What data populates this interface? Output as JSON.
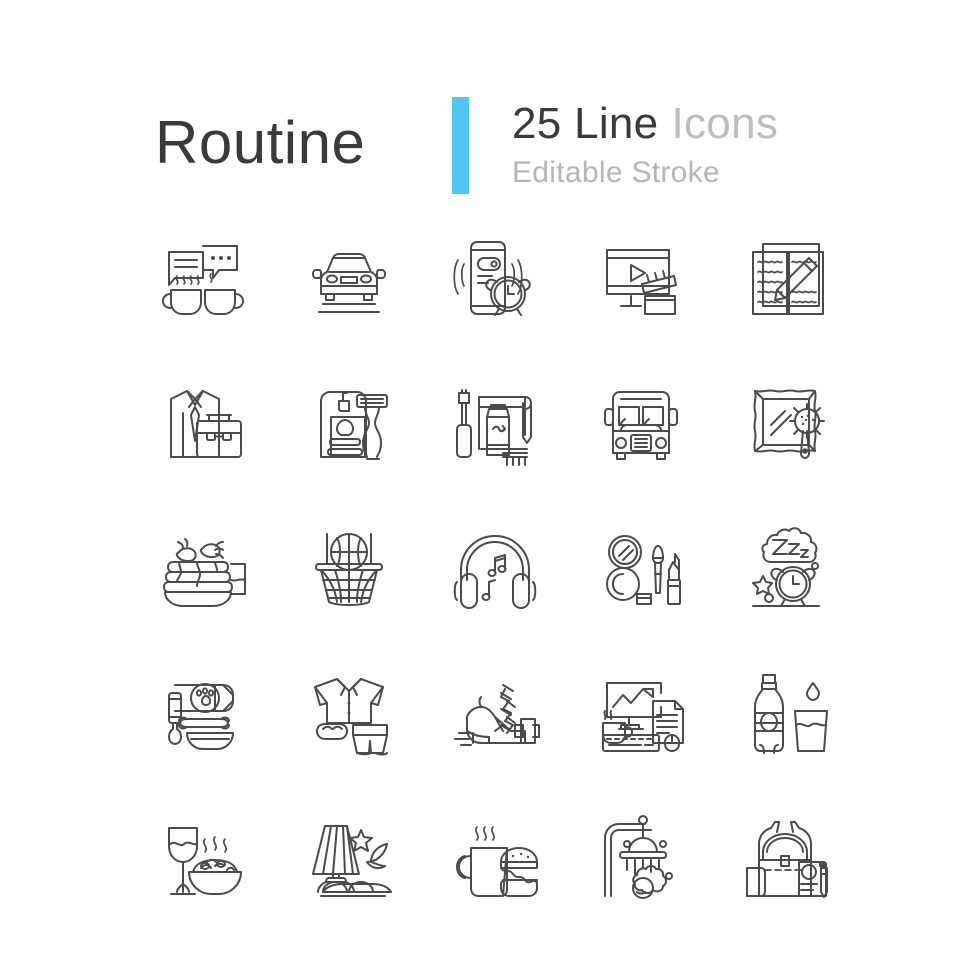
{
  "header": {
    "title": "Routine",
    "count_label": "25 Line",
    "muted_label": "Icons",
    "subtitle": "Editable Stroke",
    "accent_color": "#4ec8f0",
    "text_color": "#3a3a3c",
    "muted_color": "#b5b5b5"
  },
  "grid": {
    "columns": 5,
    "rows": 5,
    "total": 25,
    "stroke_color": "#4a4a4f",
    "background": "#ffffff"
  },
  "icons": [
    {
      "index": 1,
      "name": "coffee-chat-icon",
      "label": "Morning coffee and chat"
    },
    {
      "index": 2,
      "name": "car-commute-icon",
      "label": "Commute by car"
    },
    {
      "index": 3,
      "name": "phone-alarm-icon",
      "label": "Phone alarm clock"
    },
    {
      "index": 4,
      "name": "watch-video-icon",
      "label": "Watching video on monitor"
    },
    {
      "index": 5,
      "name": "journal-writing-icon",
      "label": "Writing in journal"
    },
    {
      "index": 6,
      "name": "work-clothes-icon",
      "label": "Shirt, tie and briefcase"
    },
    {
      "index": 7,
      "name": "shaving-icon",
      "label": "Razor and shaving foam"
    },
    {
      "index": 8,
      "name": "tooth-brushing-icon",
      "label": "Toothbrush, toothpaste and towel"
    },
    {
      "index": 9,
      "name": "school-bus-icon",
      "label": "School bus"
    },
    {
      "index": 10,
      "name": "hair-brushing-icon",
      "label": "Mirror and hairbrush"
    },
    {
      "index": 11,
      "name": "breakfast-pancakes-icon",
      "label": "Pancakes with strawberries"
    },
    {
      "index": 12,
      "name": "basketball-hoop-icon",
      "label": "Basketball practice"
    },
    {
      "index": 13,
      "name": "headphones-music-icon",
      "label": "Listening to music"
    },
    {
      "index": 14,
      "name": "makeup-icon",
      "label": "Makeup and cosmetics"
    },
    {
      "index": 15,
      "name": "sleep-alarm-icon",
      "label": "Sleeping and alarm clock"
    },
    {
      "index": 16,
      "name": "pet-feeding-icon",
      "label": "Feeding the pet"
    },
    {
      "index": 17,
      "name": "pajamas-icon",
      "label": "Pajamas and sleep mask"
    },
    {
      "index": 18,
      "name": "sneaker-workout-icon",
      "label": "Sneaker and dumbbell"
    },
    {
      "index": 19,
      "name": "office-work-icon",
      "label": "Desk work with coffee"
    },
    {
      "index": 20,
      "name": "drinking-water-icon",
      "label": "Bottle and glass of water"
    },
    {
      "index": 21,
      "name": "dinner-wine-icon",
      "label": "Dinner with wine"
    },
    {
      "index": 22,
      "name": "bedtime-lamp-icon",
      "label": "Bedside lamp and night"
    },
    {
      "index": 23,
      "name": "coffee-burger-icon",
      "label": "Coffee and burger break"
    },
    {
      "index": 24,
      "name": "shower-icon",
      "label": "Taking a shower"
    },
    {
      "index": 25,
      "name": "backpack-school-icon",
      "label": "Backpack with notebook and pen"
    }
  ]
}
